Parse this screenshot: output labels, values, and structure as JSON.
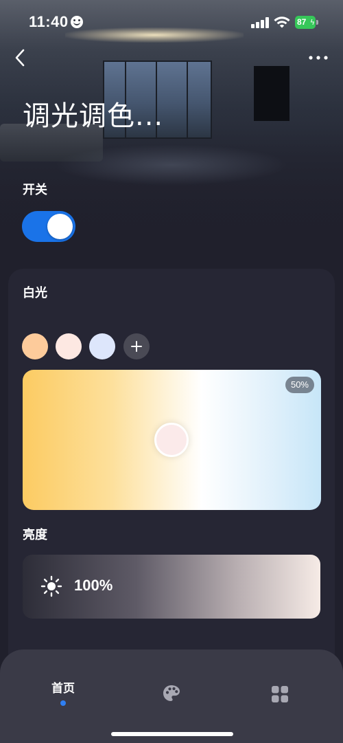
{
  "status_bar": {
    "time": "11:40",
    "battery_percent": "87"
  },
  "header": {
    "title": "调光调色..."
  },
  "power": {
    "label": "开关",
    "is_on": true,
    "accent_color": "#1a73e8"
  },
  "white_light": {
    "label": "白光",
    "presets": [
      {
        "name": "warm",
        "color": "#fdcb9b"
      },
      {
        "name": "neutral",
        "color": "#fde8e2"
      },
      {
        "name": "cool",
        "color": "#dde6fb"
      }
    ],
    "temperature_badge": "50%",
    "temperature_position_fraction": 0.5
  },
  "brightness": {
    "label": "亮度",
    "value": "100%",
    "level_fraction": 1.0
  },
  "bottom_nav": {
    "items": [
      {
        "label": "首页",
        "icon": "home",
        "active": true
      },
      {
        "label": "",
        "icon": "palette-icon",
        "active": false
      },
      {
        "label": "",
        "icon": "grid-icon",
        "active": false
      }
    ],
    "active_color": "#2f7ff2"
  }
}
